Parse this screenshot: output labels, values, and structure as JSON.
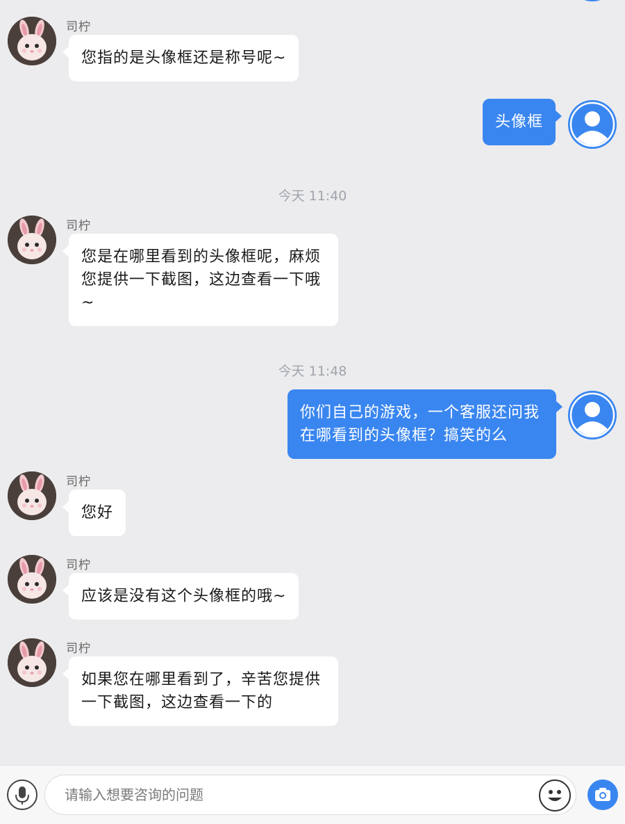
{
  "agent_name": "司柠",
  "messages": [
    {
      "from": "agent",
      "text": "您指的是头像框还是称号呢~"
    },
    {
      "from": "user",
      "text": "头像框"
    },
    {
      "time": "今天 11:40"
    },
    {
      "from": "agent",
      "text": "您是在哪里看到的头像框呢，麻烦您提供一下截图，这边查看一下哦~"
    },
    {
      "time": "今天 11:48"
    },
    {
      "from": "user",
      "text": "你们自己的游戏，一个客服还问我在哪看到的头像框？搞笑的么"
    },
    {
      "from": "agent",
      "text": "您好"
    },
    {
      "from": "agent",
      "text": "应该是没有这个头像框的哦~"
    },
    {
      "from": "agent",
      "text": "如果您在哪里看到了，辛苦您提供一下截图，这边查看一下的"
    }
  ],
  "input": {
    "placeholder": "请输入想要咨询的问题",
    "value": ""
  },
  "icons": {
    "voice": "microphone-icon",
    "emoji": "smiley-icon",
    "camera": "camera-icon",
    "user_avatar": "user-silhouette-icon",
    "agent_avatar": "cat-avatar-icon"
  },
  "colors": {
    "accent": "#3a86f0",
    "background": "#ececee",
    "bubble_in": "#ffffff"
  }
}
